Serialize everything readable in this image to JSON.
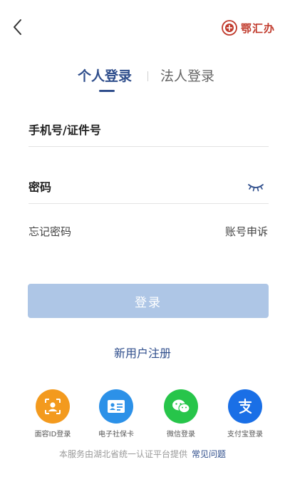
{
  "header": {
    "brand_name": "鄂汇办",
    "brand_color": "#c0392b"
  },
  "tabs": [
    {
      "label": "个人登录",
      "active": true
    },
    {
      "label": "法人登录",
      "active": false
    }
  ],
  "form": {
    "phone_placeholder": "手机号/证件号",
    "phone_value": "",
    "password_placeholder": "密码",
    "password_value": ""
  },
  "links": {
    "forgot_password": "忘记密码",
    "account_appeal": "账号申诉"
  },
  "login_button": {
    "label": "登录",
    "color": "#aec6e6"
  },
  "register": {
    "label": "新用户注册"
  },
  "alt_logins": [
    {
      "label": "面容ID登录",
      "icon": "face-id-icon",
      "color": "#f39a1e"
    },
    {
      "label": "电子社保卡",
      "icon": "id-card-icon",
      "color": "#2c91e8"
    },
    {
      "label": "微信登录",
      "icon": "wechat-icon",
      "color": "#27c54a"
    },
    {
      "label": "支付宝登录",
      "icon": "alipay-icon",
      "color": "#1a6fe6"
    }
  ],
  "footer": {
    "text": "本服务由湖北省统一认证平台提供",
    "faq_label": "常见问题"
  },
  "accent_color": "#2f4e8c"
}
